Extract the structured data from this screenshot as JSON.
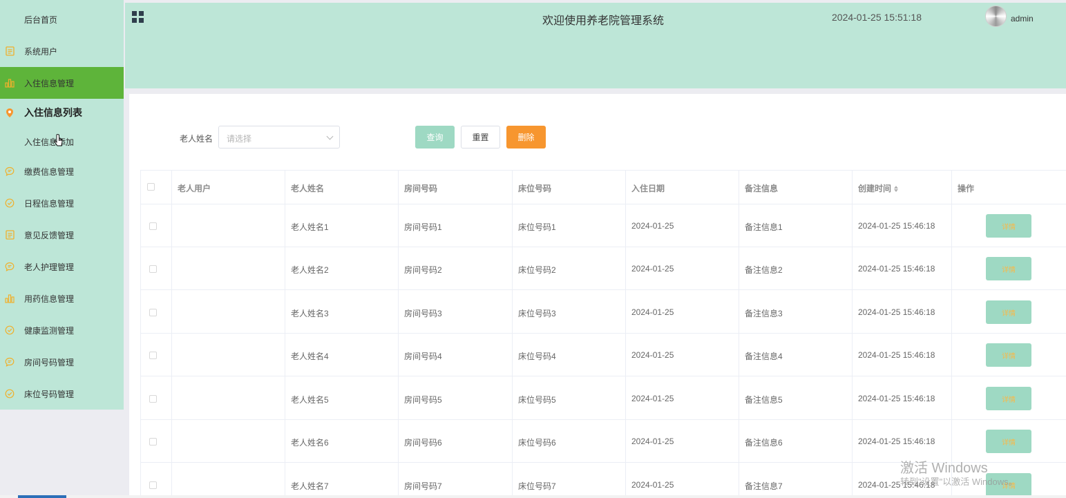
{
  "sidebar": {
    "items": [
      {
        "label": "后台首页",
        "icon": "none"
      },
      {
        "label": "系统用户",
        "icon": "document-icon"
      },
      {
        "label": "入住信息管理",
        "icon": "bar-chart-icon",
        "active": true
      },
      {
        "label": "入住信息列表",
        "icon": "location-pin-icon"
      },
      {
        "label": "入住信息添加",
        "icon": "none"
      },
      {
        "label": "缴费信息管理",
        "icon": "chat-icon"
      },
      {
        "label": "日程信息管理",
        "icon": "check-circle-icon"
      },
      {
        "label": "意见反馈管理",
        "icon": "document-icon"
      },
      {
        "label": "老人护理管理",
        "icon": "chat-icon"
      },
      {
        "label": "用药信息管理",
        "icon": "bar-chart-icon"
      },
      {
        "label": "健康监测管理",
        "icon": "check-circle-icon"
      },
      {
        "label": "房间号码管理",
        "icon": "chat-icon"
      },
      {
        "label": "床位号码管理",
        "icon": "check-circle-icon"
      }
    ]
  },
  "header": {
    "title": "欢迎使用养老院管理系统",
    "datetime": "2024-01-25 15:51:18",
    "username": "admin"
  },
  "filter": {
    "label": "老人姓名",
    "placeholder": "请选择",
    "query_label": "查询",
    "reset_label": "重置",
    "delete_label": "删除"
  },
  "table": {
    "columns": [
      "老人用户",
      "老人姓名",
      "房间号码",
      "床位号码",
      "入住日期",
      "备注信息",
      "创建时间",
      "操作"
    ],
    "detail_label": "详情",
    "rows": [
      {
        "user": "",
        "name": "老人姓名1",
        "room": "房间号码1",
        "bed": "床位号码1",
        "date": "2024-01-25",
        "note": "备注信息1",
        "created": "2024-01-25 15:46:18"
      },
      {
        "user": "",
        "name": "老人姓名2",
        "room": "房间号码2",
        "bed": "床位号码2",
        "date": "2024-01-25",
        "note": "备注信息2",
        "created": "2024-01-25 15:46:18"
      },
      {
        "user": "",
        "name": "老人姓名3",
        "room": "房间号码3",
        "bed": "床位号码3",
        "date": "2024-01-25",
        "note": "备注信息3",
        "created": "2024-01-25 15:46:18"
      },
      {
        "user": "",
        "name": "老人姓名4",
        "room": "房间号码4",
        "bed": "床位号码4",
        "date": "2024-01-25",
        "note": "备注信息4",
        "created": "2024-01-25 15:46:18"
      },
      {
        "user": "",
        "name": "老人姓名5",
        "room": "房间号码5",
        "bed": "床位号码5",
        "date": "2024-01-25",
        "note": "备注信息5",
        "created": "2024-01-25 15:46:18"
      },
      {
        "user": "",
        "name": "老人姓名6",
        "room": "房间号码6",
        "bed": "床位号码6",
        "date": "2024-01-25",
        "note": "备注信息6",
        "created": "2024-01-25 15:46:18"
      },
      {
        "user": "",
        "name": "老人姓名7",
        "room": "房间号码7",
        "bed": "床位号码7",
        "date": "2024-01-25",
        "note": "备注信息7",
        "created": "2024-01-25 15:46:18"
      }
    ]
  },
  "watermark": {
    "line1": "激活 Windows",
    "line2": "转到\"设置\"以激活 Windows。"
  },
  "colors": {
    "accent": "#bde6d7",
    "active_menu": "#5eb43a",
    "icon": "#f0b02c",
    "button_primary": "#9ed9c3",
    "button_danger": "#f7962f"
  }
}
